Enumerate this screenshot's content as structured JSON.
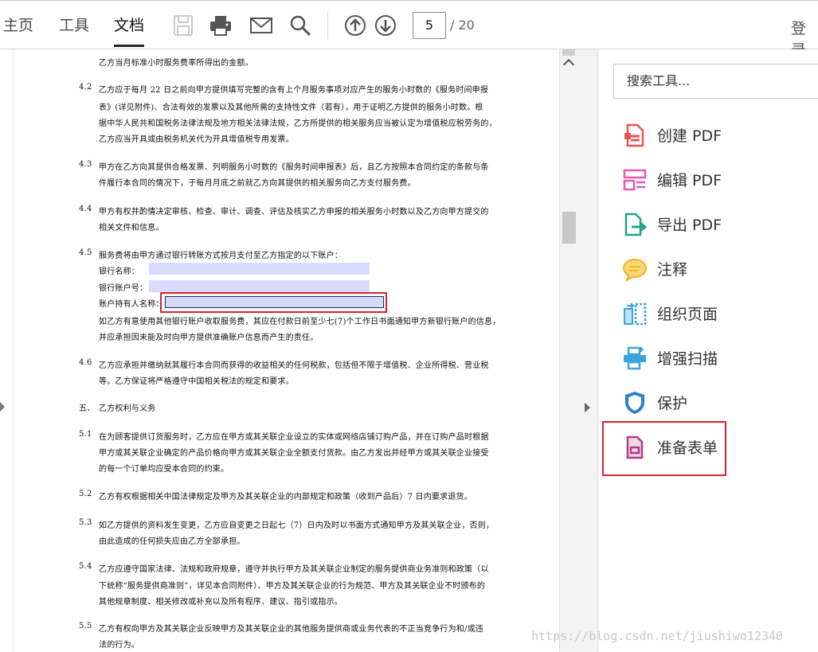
{
  "toolbar": {
    "tabs": [
      "主页",
      "工具",
      "文档"
    ],
    "active_tab": "文档",
    "icons": [
      "save-icon",
      "print-icon",
      "mail-icon",
      "search-icon",
      "page-up-icon",
      "page-down-icon"
    ],
    "page_current": "5",
    "page_total": "/ 20",
    "login_label": "登录"
  },
  "document": {
    "lines": [
      {
        "n": "",
        "t": "乙方当月标准小时服务费率所得出的金额。"
      },
      {
        "n": "4.2",
        "t": "乙方应于每月 22 日之前向甲方提供填写完整的含有上个月服务事项对应产生的服务小时数的《服务时间申报"
      },
      {
        "n": "",
        "t": "表》(详见附件)、合法有效的发票以及其他所需的支持性文件（若有），用于证明乙方提供的服务小时数。根"
      },
      {
        "n": "",
        "t": "据中华人民共和国税务法律法规及地方相关法律法规，乙方所提供的相关服务应当被认定为增值税应税劳务的，"
      },
      {
        "n": "",
        "t": "乙方应当开具或由税务机关代为开具增值税专用发票。"
      },
      {
        "n": "4.3",
        "t": "甲方在乙方向其提供合格发票、列明服务小时数的《服务时间申报表》后，且乙方按照本合同约定的条款与条"
      },
      {
        "n": "",
        "t": "件履行本合同的情况下，于每月月底之前就乙方向其提供的相关服务向乙方支付服务费。"
      },
      {
        "n": "4.4",
        "t": "甲方有权并酌情决定审核、检查、审计、调查、评估及核实乙方申报的相关服务小时数以及乙方向甲方提交的"
      },
      {
        "n": "",
        "t": "相关文件和信息。"
      },
      {
        "n": "4.5",
        "t": "服务费将由甲方通过银行转账方式按月支付至乙方指定的以下账户："
      },
      {
        "n": "",
        "t": "银行名称："
      },
      {
        "n": "",
        "t": "银行账户号："
      },
      {
        "n": "",
        "t": "账户持有人名称："
      },
      {
        "n": "",
        "t": "如乙方有意使用其他银行账户收取服务费，其应在付款日前至少七(7)个工作日书面通知甲方新银行账户的信息，"
      },
      {
        "n": "",
        "t": "并应承担因未能及时向甲方提供准确账户信息而产生的责任。"
      },
      {
        "n": "4.6",
        "t": "乙方应承担并缴纳就其履行本合同而获得的收益相关的任何税款，包括但不限于增值税、企业所得税、营业税"
      },
      {
        "n": "",
        "t": "等。乙方保证将严格遵守中国相关税法的规定和要求。"
      },
      {
        "n": "五、",
        "t": "乙方权利与义务"
      },
      {
        "n": "5.1",
        "t": "在为顾客提供订货服务时，乙方应在甲方或其关联企业设立的实体或网络店铺订购产品，并在订购产品时根据"
      },
      {
        "n": "",
        "t": "甲方或其关联企业确定的产品价格向甲方或其关联企业全额支付货款。由乙方发出并经甲方或其关联企业接受"
      },
      {
        "n": "",
        "t": "的每一个订单均应受本合同的约束。"
      },
      {
        "n": "5.2",
        "t": "乙方有权根据相关中国法律规定及甲方及其关联企业的内部规定和政策（收到产品后）7 日内要求退货。"
      },
      {
        "n": "5.3",
        "t": "如乙方提供的资料发生变更，乙方应自变更之日起七（7）日内及时以书面方式通知甲方及其关联企业，否则，"
      },
      {
        "n": "",
        "t": "由此造成的任何损失应由乙方全部承担。"
      },
      {
        "n": "5.4",
        "t": "乙方应遵守国家法律、法规和政府规章，遵守并执行甲方及其关联企业制定的服务提供商业务准则和政策（以"
      },
      {
        "n": "",
        "t": "下统称“服务提供商准则”，详见本合同附件）、甲方及其关联企业的行为规范、甲方及其关联企业不时颁布的"
      },
      {
        "n": "",
        "t": "其他规章制度、相关修改或补充以及所有程序、建议、指引或指示。"
      },
      {
        "n": "5.5",
        "t": "乙方有权向甲方及其关联企业反映甲方及其关联企业的其他服务提供商或业务代表的不正当竞争行为和/或违"
      },
      {
        "n": "",
        "t": "法的行为。"
      }
    ]
  },
  "panel": {
    "search_placeholder": "搜索工具...",
    "tools": [
      {
        "label": "创建 PDF",
        "icon": "create-pdf-icon",
        "color": "#e8554e"
      },
      {
        "label": "编辑 PDF",
        "icon": "edit-pdf-icon",
        "color": "#e55bb3"
      },
      {
        "label": "导出 PDF",
        "icon": "export-pdf-icon",
        "color": "#23a488"
      },
      {
        "label": "注释",
        "icon": "comment-icon",
        "color": "#f2b21c"
      },
      {
        "label": "组织页面",
        "icon": "organize-pages-icon",
        "color": "#3aa6dd"
      },
      {
        "label": "增强扫描",
        "icon": "enhance-scan-icon",
        "color": "#3aa6dd"
      },
      {
        "label": "保护",
        "icon": "protect-icon",
        "color": "#2b7fd1"
      },
      {
        "label": "准备表单",
        "icon": "prepare-form-icon",
        "color": "#b23b86"
      }
    ]
  },
  "watermark": "https://blog.csdn.net/jiushiwo12340"
}
